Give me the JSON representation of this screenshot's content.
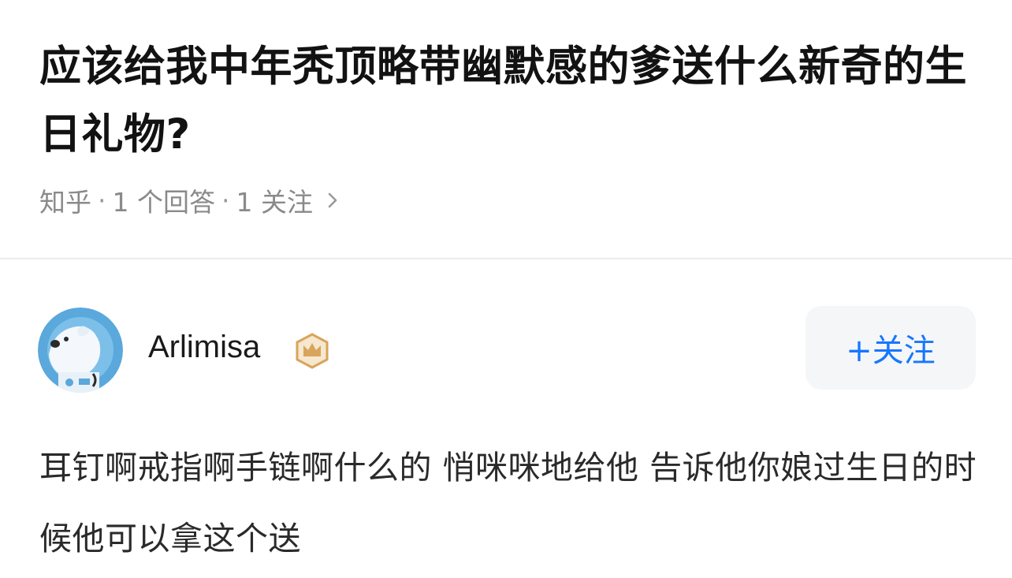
{
  "question": {
    "title": "应该给我中年秃顶略带幽默感的爹送什么新奇的生日礼物?",
    "source": "知乎",
    "answers": "1 个回答",
    "followers": "1 关注",
    "separator": "·"
  },
  "author": {
    "name": "Arlimisa",
    "badge_icon": "crown-badge-icon",
    "follow_label": "+关注"
  },
  "answer": {
    "text": "耳钉啊戒指啊手链啊什么的 悄咪咪地给他 告诉他你娘过生日的时候他可以拿这个送"
  },
  "colors": {
    "accent": "#1677ff",
    "meta_text": "#8a8a8a",
    "badge": "#d9a45b"
  }
}
